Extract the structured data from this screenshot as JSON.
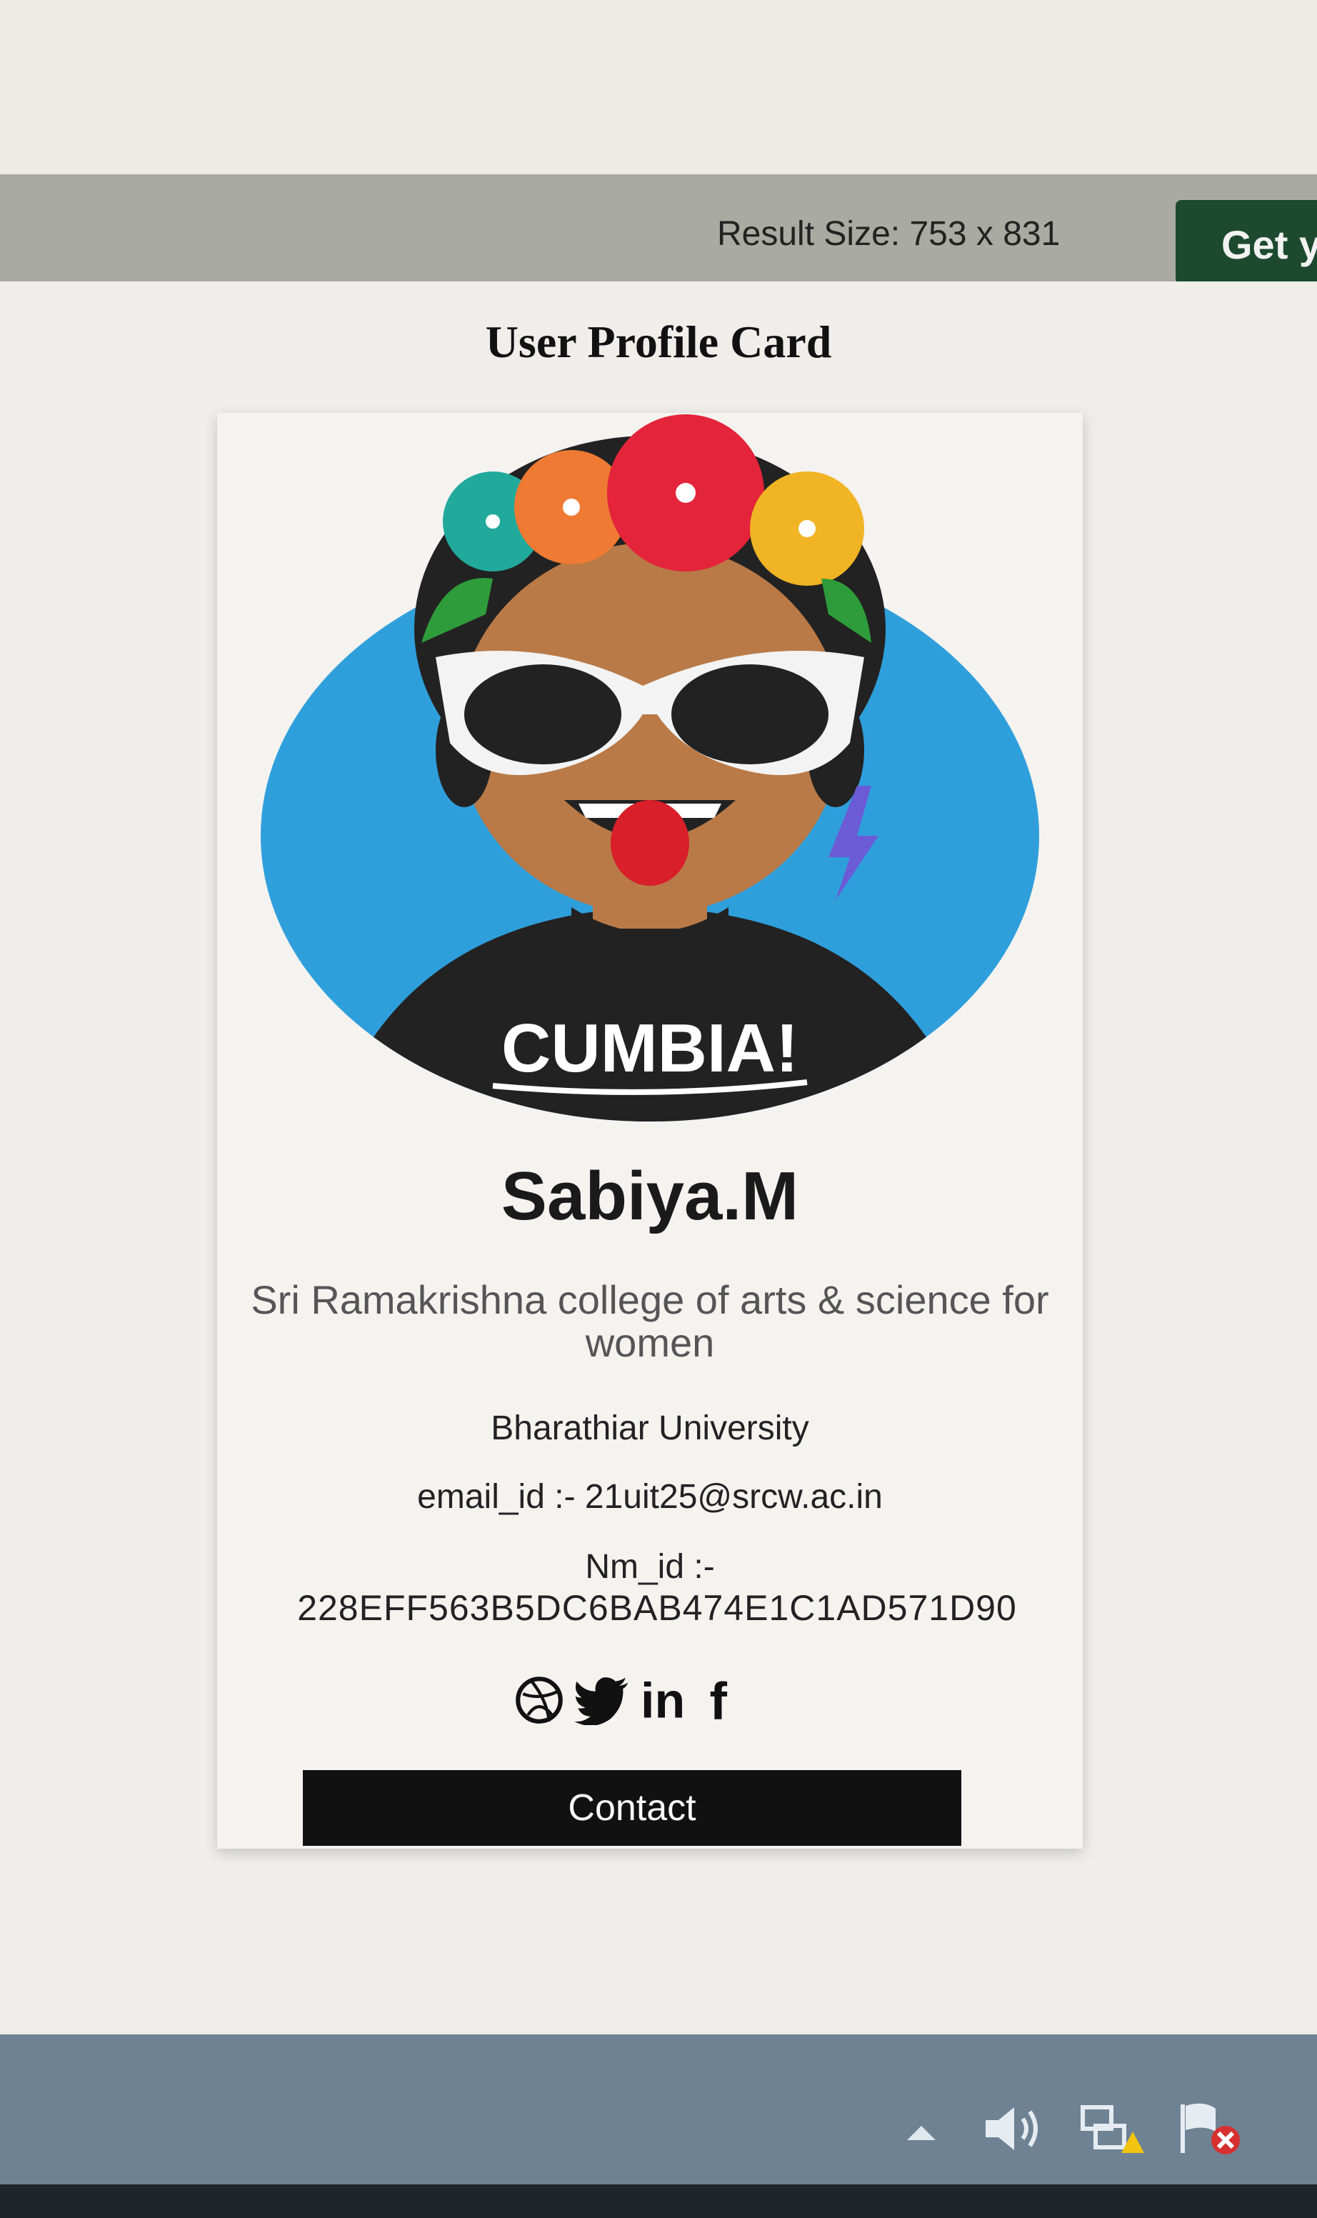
{
  "toolbar": {
    "result_size": "Result Size: 753 x 831",
    "get_button_label": "Get y"
  },
  "page": {
    "title": "User Profile Card"
  },
  "profile": {
    "avatar_shirt_text": "CUMBIA!",
    "name": "Sabiya.M",
    "college": "Sri Ramakrishna college of arts & science for women",
    "university": "Bharathiar University",
    "email": "email_id :- 21uit25@srcw.ac.in",
    "nm_label": "Nm_id :-",
    "nm_value": "228EFF563B5DC6BAB474E1C1AD571D90",
    "social_icons": [
      "dribbble-icon",
      "twitter-icon",
      "linkedin-icon",
      "facebook-icon"
    ],
    "social_labels": {
      "linkedin": "in",
      "facebook": "f"
    },
    "contact_label": "Contact"
  },
  "tray": {
    "icons": [
      "show-hidden-icons-arrow",
      "speaker-icon",
      "network-warning-icon",
      "action-center-flag-icon"
    ]
  },
  "colors": {
    "avatar_bg": "#2f9fdc",
    "button_bg": "#111111",
    "toolbar_bg": "#a9aaa1",
    "get_button_bg": "#1d4a2e",
    "taskbar_bg": "#6e8294"
  }
}
